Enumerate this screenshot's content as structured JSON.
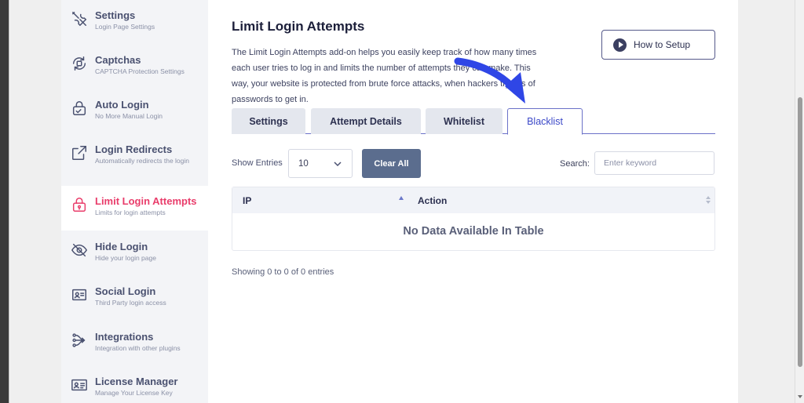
{
  "sidebar": {
    "items": [
      {
        "icon": "tools-icon",
        "title": "Settings",
        "subtitle": "Login Page Settings"
      },
      {
        "icon": "captcha-icon",
        "title": "Captchas",
        "subtitle": "CAPTCHA Protection Settings"
      },
      {
        "icon": "lock-icon",
        "title": "Auto Login",
        "subtitle": "No More Manual Login"
      },
      {
        "icon": "external-link-icon",
        "title": "Login Redirects",
        "subtitle": "Automatically redirects the login"
      },
      {
        "icon": "padlock-icon",
        "title": "Limit Login Attempts",
        "subtitle": "Limits for login attempts",
        "active": true
      },
      {
        "icon": "eye-off-icon",
        "title": "Hide Login",
        "subtitle": "Hide your login page"
      },
      {
        "icon": "id-card-icon",
        "title": "Social Login",
        "subtitle": "Third Party login access"
      },
      {
        "icon": "integration-icon",
        "title": "Integrations",
        "subtitle": "Integration with other plugins"
      },
      {
        "icon": "license-icon",
        "title": "License Manager",
        "subtitle": "Manage Your License Key"
      }
    ]
  },
  "main": {
    "title": "Limit Login Attempts",
    "description": "The Limit Login Attempts add-on helps you easily keep track of how many times each user tries to log in and limits the number of attempts they can make. This way, your website is protected from brute force attacks, when hackers try lots of passwords to get in.",
    "how_to_setup": "How to Setup",
    "tabs": [
      {
        "label": "Settings"
      },
      {
        "label": "Attempt Details"
      },
      {
        "label": "Whitelist"
      },
      {
        "label": "Blacklist",
        "active": true
      }
    ],
    "show_entries_label": "Show Entries",
    "entries_value": "10",
    "clear_all": "Clear All",
    "search_label": "Search:",
    "search_placeholder": "Enter keyword",
    "table": {
      "columns": [
        "IP",
        "Action"
      ],
      "empty_text": "No Data Available In Table"
    },
    "showing_text": "Showing 0 to 0 of 0 entries"
  },
  "colors": {
    "accent": "#3c49c8",
    "active_sidebar": "#e93d6b",
    "annotation_arrow": "#2f46e6",
    "clear_button": "#5b6d8e"
  }
}
